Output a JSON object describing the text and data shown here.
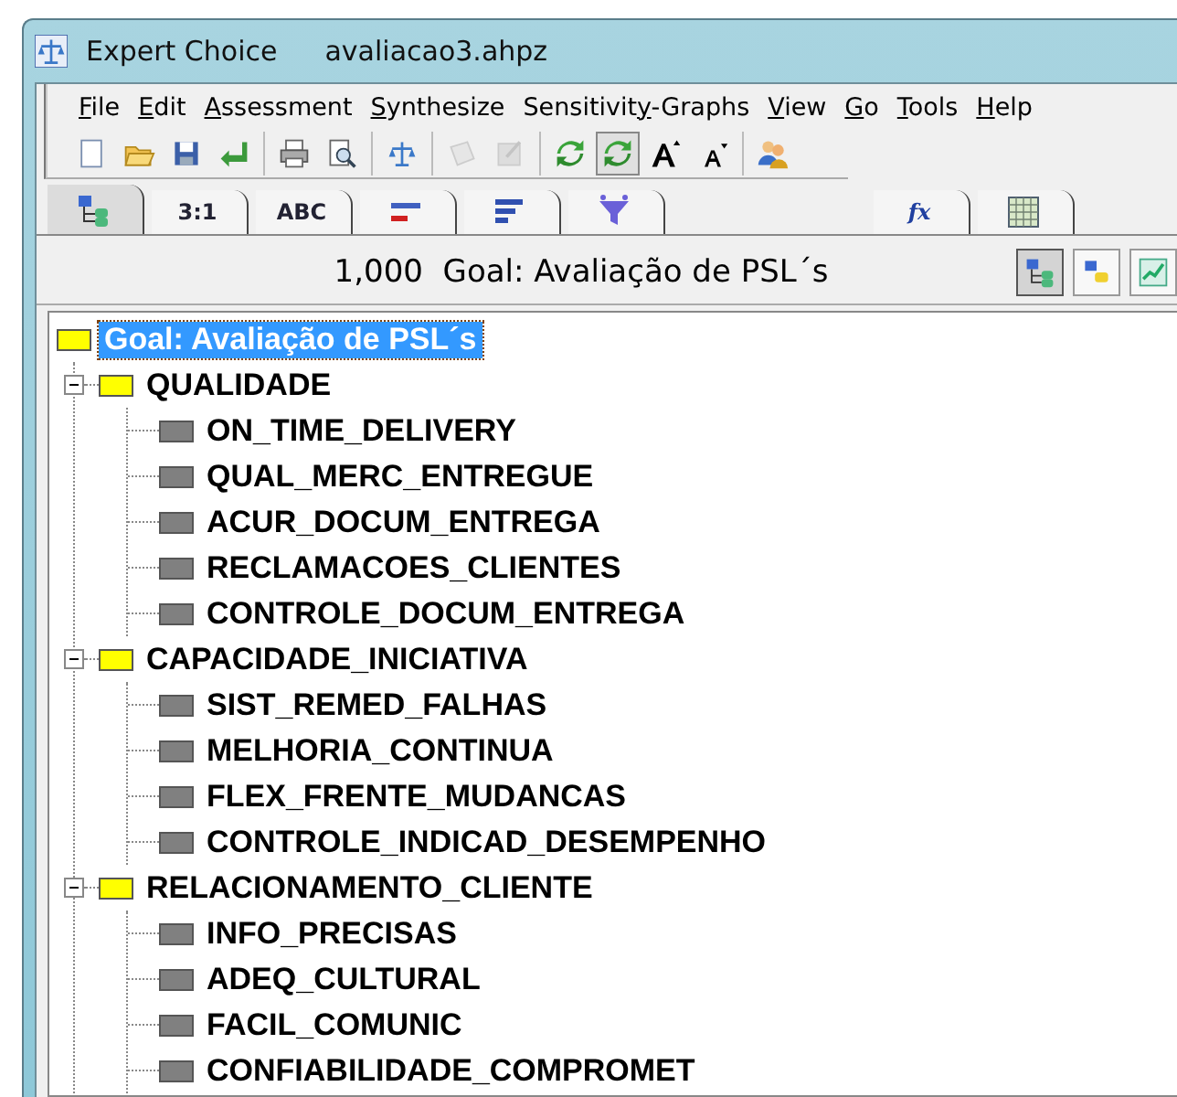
{
  "window": {
    "title": "Expert Choice",
    "file": "avaliacao3.ahpz"
  },
  "menu": [
    {
      "parts": [
        {
          "text": "F",
          "underline": true
        },
        {
          "text": "ile",
          "underline": false
        }
      ]
    },
    {
      "parts": [
        {
          "text": "E",
          "underline": true
        },
        {
          "text": "dit",
          "underline": false
        }
      ]
    },
    {
      "parts": [
        {
          "text": "A",
          "underline": true
        },
        {
          "text": "ssessment",
          "underline": false
        }
      ]
    },
    {
      "parts": [
        {
          "text": "S",
          "underline": true
        },
        {
          "text": "ynthesize",
          "underline": false
        }
      ]
    },
    {
      "parts": [
        {
          "text": "Sensitivit",
          "underline": false
        },
        {
          "text": "y",
          "underline": true
        },
        {
          "text": "-Graphs",
          "underline": false
        }
      ]
    },
    {
      "parts": [
        {
          "text": "V",
          "underline": true
        },
        {
          "text": "iew",
          "underline": false
        }
      ]
    },
    {
      "parts": [
        {
          "text": "G",
          "underline": true
        },
        {
          "text": "o",
          "underline": false
        }
      ]
    },
    {
      "parts": [
        {
          "text": "T",
          "underline": true
        },
        {
          "text": "ools",
          "underline": false
        }
      ]
    },
    {
      "parts": [
        {
          "text": "H",
          "underline": true
        },
        {
          "text": "elp",
          "underline": false
        }
      ]
    }
  ],
  "toolbar": [
    [
      {
        "kind": "new",
        "pressed": false,
        "disabled": false
      },
      {
        "kind": "open",
        "pressed": false,
        "disabled": false
      },
      {
        "kind": "save",
        "pressed": false,
        "disabled": false
      },
      {
        "kind": "return",
        "pressed": false,
        "disabled": false
      }
    ],
    [
      {
        "kind": "print",
        "pressed": false,
        "disabled": false
      },
      {
        "kind": "preview",
        "pressed": false,
        "disabled": false
      }
    ],
    [
      {
        "kind": "balance",
        "pressed": false,
        "disabled": false
      }
    ],
    [
      {
        "kind": "document",
        "pressed": false,
        "disabled": true
      },
      {
        "kind": "edit",
        "pressed": false,
        "disabled": true
      }
    ],
    [
      {
        "kind": "refresh",
        "pressed": false,
        "disabled": false
      },
      {
        "kind": "refresh",
        "pressed": true,
        "disabled": false
      },
      {
        "kind": "font_up",
        "pressed": false,
        "disabled": false
      },
      {
        "kind": "font_down",
        "pressed": false,
        "disabled": false
      }
    ],
    [
      {
        "kind": "people",
        "pressed": false,
        "disabled": false
      }
    ]
  ],
  "tabs": [
    {
      "kind": "tree",
      "selected": true
    },
    {
      "kind": "text",
      "label": "3:1",
      "selected": false
    },
    {
      "kind": "text",
      "label": "ABC",
      "selected": false
    },
    {
      "kind": "bars",
      "selected": false
    },
    {
      "kind": "list",
      "selected": false
    },
    {
      "kind": "funnel",
      "selected": false
    },
    {
      "kind": "formula",
      "label": "fx",
      "selected": false
    },
    {
      "kind": "grid",
      "selected": false
    }
  ],
  "goal_bar": {
    "priority": "1,000",
    "label": "Goal: Avaliação de PSL´s",
    "buttons": [
      {
        "kind": "tree",
        "pressed": true
      },
      {
        "kind": "nodes",
        "pressed": false
      },
      {
        "kind": "chart",
        "pressed": false
      }
    ]
  },
  "tree": {
    "label": "Goal: Avaliação de PSL´s",
    "color": "#ffff00",
    "selected": true,
    "children": [
      {
        "label": "QUALIDADE",
        "color": "#ffff00",
        "selected": false,
        "expanded": true,
        "children": [
          {
            "label": "ON_TIME_DELIVERY",
            "color": "#808080",
            "selected": false
          },
          {
            "label": "QUAL_MERC_ENTREGUE",
            "color": "#808080",
            "selected": false
          },
          {
            "label": "ACUR_DOCUM_ENTREGA",
            "color": "#808080",
            "selected": false
          },
          {
            "label": "RECLAMACOES_CLIENTES",
            "color": "#808080",
            "selected": false
          },
          {
            "label": "CONTROLE_DOCUM_ENTREGA",
            "color": "#808080",
            "selected": false
          }
        ]
      },
      {
        "label": "CAPACIDADE_INICIATIVA",
        "color": "#ffff00",
        "selected": false,
        "expanded": true,
        "children": [
          {
            "label": "SIST_REMED_FALHAS",
            "color": "#808080",
            "selected": false
          },
          {
            "label": "MELHORIA_CONTINUA",
            "color": "#808080",
            "selected": false
          },
          {
            "label": "FLEX_FRENTE_MUDANCAS",
            "color": "#808080",
            "selected": false
          },
          {
            "label": "CONTROLE_INDICAD_DESEMPENHO",
            "color": "#808080",
            "selected": false
          }
        ]
      },
      {
        "label": "RELACIONAMENTO_CLIENTE",
        "color": "#ffff00",
        "selected": false,
        "expanded": true,
        "children": [
          {
            "label": "INFO_PRECISAS",
            "color": "#808080",
            "selected": false
          },
          {
            "label": "ADEQ_CULTURAL",
            "color": "#808080",
            "selected": false
          },
          {
            "label": "FACIL_COMUNIC",
            "color": "#808080",
            "selected": false
          },
          {
            "label": "CONFIABILIDADE_COMPROMET",
            "color": "#808080",
            "selected": false
          }
        ]
      }
    ]
  }
}
